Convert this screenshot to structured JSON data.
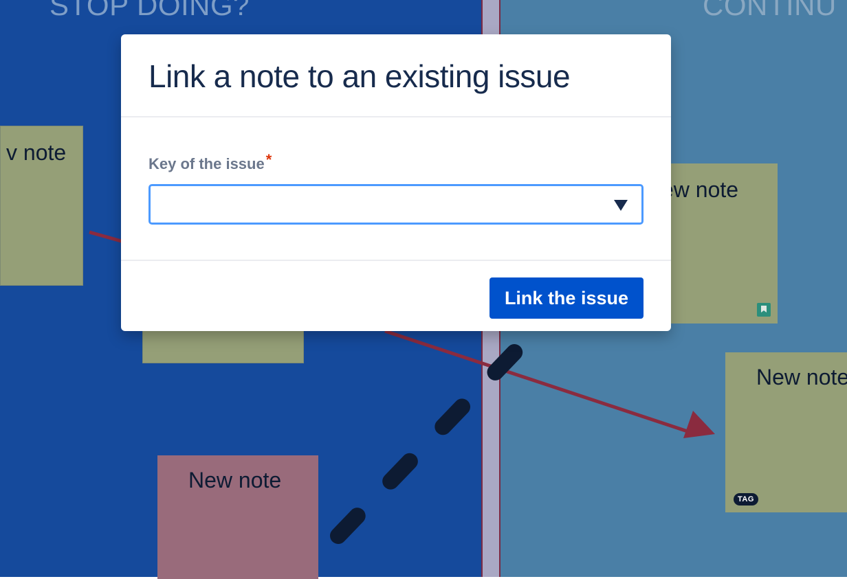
{
  "board": {
    "columns": [
      {
        "title": "STOP DOING?"
      },
      {
        "title": "CONTINU"
      }
    ],
    "notes": [
      {
        "text": "v note"
      },
      {
        "text": ""
      },
      {
        "text": "New note"
      },
      {
        "text": "ew note"
      },
      {
        "text": "New note"
      }
    ],
    "tag_label": "TAG"
  },
  "modal": {
    "title": "Link a note to an existing issue",
    "field_label": "Key of the issue",
    "required_marker": "*",
    "select_value": "",
    "submit_label": "Link the issue"
  },
  "colors": {
    "left_column": "#154a9c",
    "right_column": "#4a7fa6",
    "primary_button": "#0052cc",
    "focus_border": "#4c9aff",
    "required": "#de350b"
  }
}
